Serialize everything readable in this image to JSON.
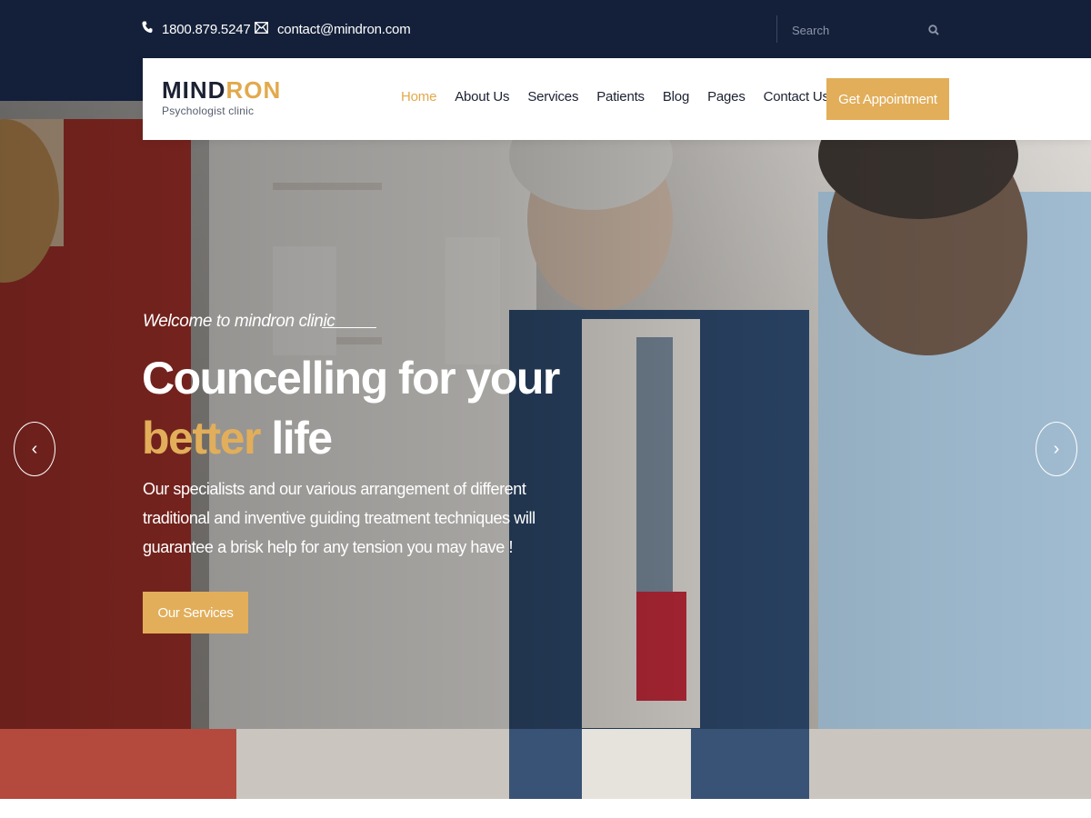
{
  "topbar": {
    "phone": "1800.879.5247",
    "email": "contact@mindron.com",
    "phone_icon": "phone-icon",
    "email_icon": "envelope-icon",
    "search": {
      "placeholder": "Search",
      "icon": "search-icon"
    }
  },
  "navbar": {
    "logo": {
      "main_prefix": "MIND",
      "main_suffix": "RON",
      "subtitle": "Psychologist clinic"
    },
    "menu": [
      {
        "label": "Home",
        "active": true
      },
      {
        "label": "About Us"
      },
      {
        "label": "Services"
      },
      {
        "label": "Patients"
      },
      {
        "label": "Blog"
      },
      {
        "label": "Pages"
      },
      {
        "label": "Contact Us"
      }
    ],
    "cta_label": "Get Appointment"
  },
  "hero": {
    "welcome": "Welcome to mindron clinic",
    "headline_line1": "Councelling for your",
    "headline_accent": "better",
    "headline_rest": " life",
    "description": "Our specialists and our various arrangement of different traditional and inventive guiding treatment techniques will guarantee a brisk help for any tension you may have !",
    "button_label": "Our Services",
    "prev_arrow": "‹",
    "next_arrow": "›"
  },
  "colors": {
    "topbar_bg": "#14203a",
    "accent": "#e2ae5a",
    "text_dark": "#1c2233"
  }
}
